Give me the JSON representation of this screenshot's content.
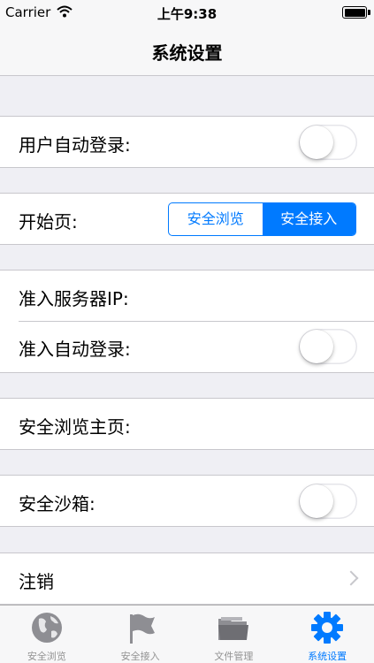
{
  "status_bar": {
    "carrier": "Carrier",
    "time": "上午9:38"
  },
  "nav": {
    "title": "系统设置"
  },
  "settings": {
    "auto_login": {
      "label": "用户自动登录:",
      "enabled": false
    },
    "start_page": {
      "label": "开始页:",
      "options": [
        "安全浏览",
        "安全接入"
      ],
      "selected": "安全接入"
    },
    "access_server_ip": {
      "label": "准入服务器IP:"
    },
    "access_auto_login": {
      "label": "准入自动登录:",
      "enabled": false
    },
    "secure_browse_home": {
      "label": "安全浏览主页:"
    },
    "sandbox": {
      "label": "安全沙箱:",
      "enabled": false
    },
    "logout": {
      "label": "注销"
    }
  },
  "tabs": [
    {
      "label": "安全浏览",
      "icon": "globe-icon",
      "active": false
    },
    {
      "label": "安全接入",
      "icon": "flag-icon",
      "active": false
    },
    {
      "label": "文件管理",
      "icon": "folder-icon",
      "active": false
    },
    {
      "label": "系统设置",
      "icon": "gear-icon",
      "active": true
    }
  ],
  "colors": {
    "accent": "#007aff",
    "background": "#efeff4",
    "tab_inactive": "#929292"
  }
}
